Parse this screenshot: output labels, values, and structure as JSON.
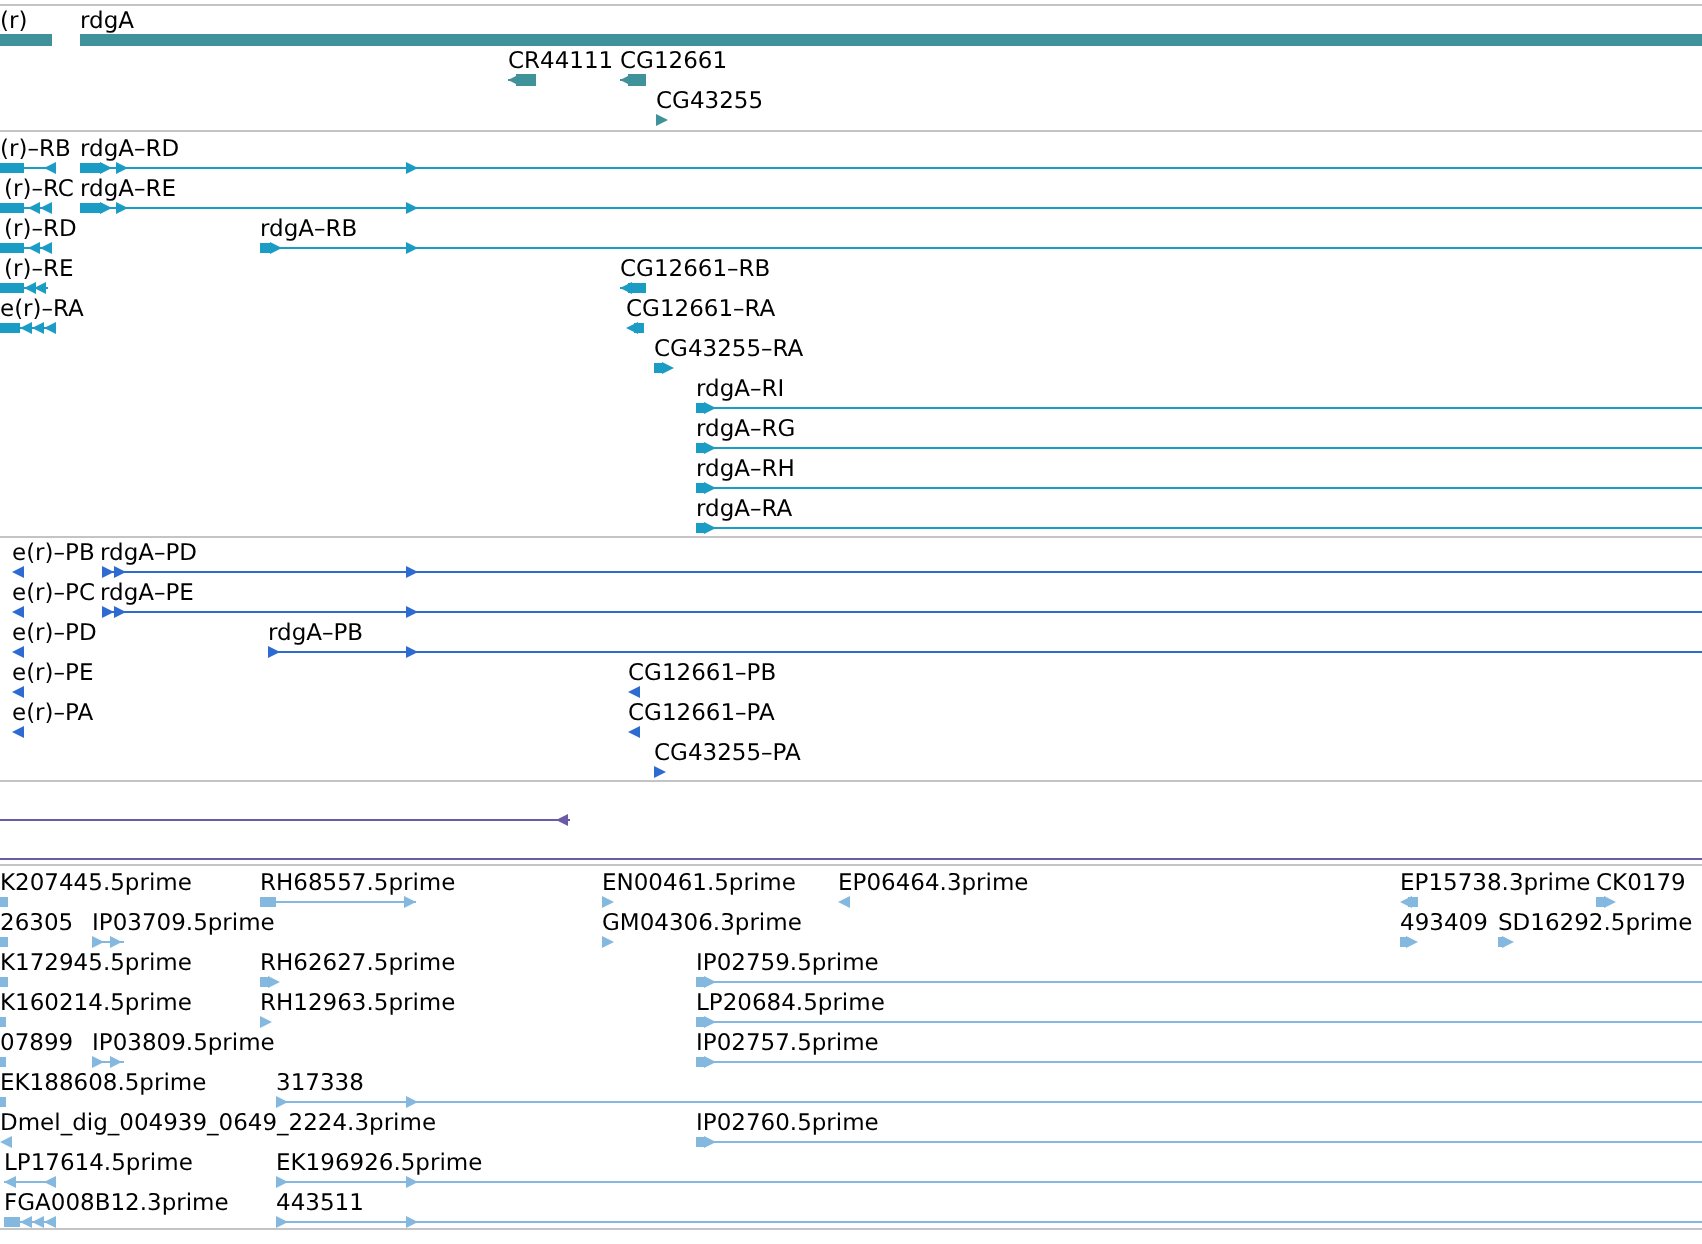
{
  "tracks": [
    {
      "color": "#3f9299",
      "features": [
        {
          "label": "(r)"
        },
        {
          "label": "rdgA"
        },
        {
          "label": "CR44111",
          "reverse": true
        },
        {
          "label": "CG12661",
          "reverse": true
        },
        {
          "label": "CG43255",
          "reverse": false
        }
      ]
    },
    {
      "color": "#1a9cc4",
      "features": [
        {
          "label": "(r)–RB",
          "reverse": true
        },
        {
          "label": "rdgA–RD",
          "reverse": false
        },
        {
          "label": "(r)–RC",
          "reverse": true
        },
        {
          "label": "rdgA–RE",
          "reverse": false
        },
        {
          "label": "(r)–RD",
          "reverse": true
        },
        {
          "label": "rdgA–RB",
          "reverse": false
        },
        {
          "label": "(r)–RE",
          "reverse": true
        },
        {
          "label": "CG12661–RB",
          "reverse": true
        },
        {
          "label": "e(r)–RA",
          "reverse": true
        },
        {
          "label": "CG12661–RA",
          "reverse": true
        },
        {
          "label": "CG43255–RA",
          "reverse": false
        },
        {
          "label": "rdgA–RI",
          "reverse": false
        },
        {
          "label": "rdgA–RG",
          "reverse": false
        },
        {
          "label": "rdgA–RH",
          "reverse": false
        },
        {
          "label": "rdgA–RA",
          "reverse": false
        }
      ]
    },
    {
      "color": "#2e6bd1",
      "features": [
        {
          "label": "e(r)–PB",
          "reverse": true
        },
        {
          "label": "rdgA–PD",
          "reverse": false
        },
        {
          "label": "e(r)–PC",
          "reverse": true
        },
        {
          "label": "rdgA–PE",
          "reverse": false
        },
        {
          "label": "e(r)–PD",
          "reverse": true
        },
        {
          "label": "rdgA–PB",
          "reverse": false
        },
        {
          "label": "e(r)–PE",
          "reverse": true
        },
        {
          "label": "CG12661–PB",
          "reverse": true
        },
        {
          "label": "e(r)–PA",
          "reverse": true
        },
        {
          "label": "CG12661–PA",
          "reverse": true
        },
        {
          "label": "CG43255–PA",
          "reverse": false
        }
      ]
    },
    {
      "color": "#6a5aa8",
      "features": [
        {
          "reverse": true
        }
      ]
    },
    {
      "color": "#84b8de",
      "features": [
        {
          "label": "K207445.5prime"
        },
        {
          "label": "RH68557.5prime",
          "reverse": false
        },
        {
          "label": "EN00461.5prime",
          "reverse": false
        },
        {
          "label": "EP06464.3prime",
          "reverse": true
        },
        {
          "label": "EP15738.3prime",
          "reverse": true
        },
        {
          "label": "CK0179",
          "reverse": false
        },
        {
          "label": "26305"
        },
        {
          "label": "IP03709.5prime",
          "reverse": false
        },
        {
          "label": "GM04306.3prime",
          "reverse": false
        },
        {
          "label": "493409",
          "reverse": false
        },
        {
          "label": "SD16292.5prime",
          "reverse": false
        },
        {
          "label": "K172945.5prime"
        },
        {
          "label": "RH62627.5prime",
          "reverse": false
        },
        {
          "label": "IP02759.5prime",
          "reverse": false
        },
        {
          "label": "K160214.5prime"
        },
        {
          "label": "RH12963.5prime",
          "reverse": false
        },
        {
          "label": "LP20684.5prime",
          "reverse": false
        },
        {
          "label": "07899"
        },
        {
          "label": "IP03809.5prime",
          "reverse": false
        },
        {
          "label": "IP02757.5prime",
          "reverse": false
        },
        {
          "label": "EK188608.5prime"
        },
        {
          "label": "317338",
          "reverse": false
        },
        {
          "label": "Dmel_dig_004939_0649_2224.3prime",
          "reverse": true
        },
        {
          "label": "IP02760.5prime",
          "reverse": false
        },
        {
          "label": "LP17614.5prime",
          "reverse": true
        },
        {
          "label": "EK196926.5prime",
          "reverse": false
        },
        {
          "label": "FGA008B12.3prime",
          "reverse": true
        },
        {
          "label": "443511",
          "reverse": false
        }
      ]
    }
  ]
}
